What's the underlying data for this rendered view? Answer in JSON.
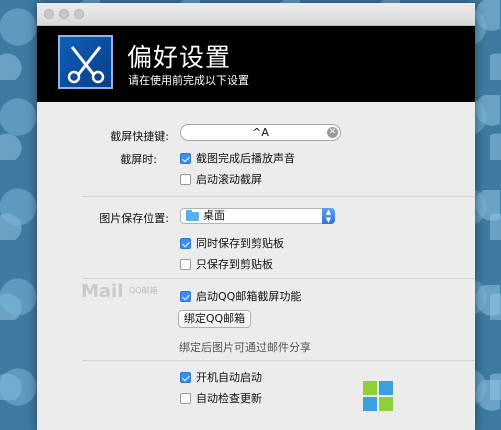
{
  "header": {
    "title": "偏好设置",
    "subtitle": "请在使用前完成以下设置"
  },
  "hotkey": {
    "label": "截屏快捷键:",
    "value": "^A"
  },
  "screenshot": {
    "label": "截屏时:",
    "options": [
      {
        "label": "截图完成后播放声音",
        "checked": true
      },
      {
        "label": "启动滚动截屏",
        "checked": false
      }
    ]
  },
  "save": {
    "label": "图片保存位置:",
    "location": "桌面",
    "options": [
      {
        "label": "同时保存到剪贴板",
        "checked": true
      },
      {
        "label": "只保存到剪贴板",
        "checked": false
      }
    ]
  },
  "qqmail": {
    "logo_text": "Mail",
    "logo_cn": "QQ邮箱",
    "option": {
      "label": "启动QQ邮箱截屏功能",
      "checked": true
    },
    "bind_button": "绑定QQ邮箱",
    "note": "绑定后图片可通过邮件分享"
  },
  "startup": {
    "options": [
      {
        "label": "开机自动启动",
        "checked": true
      },
      {
        "label": "自动检查更新",
        "checked": false
      }
    ]
  },
  "colors": {
    "accent": "#3a8ef0",
    "header_bg": "#000000",
    "window_bg": "#ececec"
  }
}
